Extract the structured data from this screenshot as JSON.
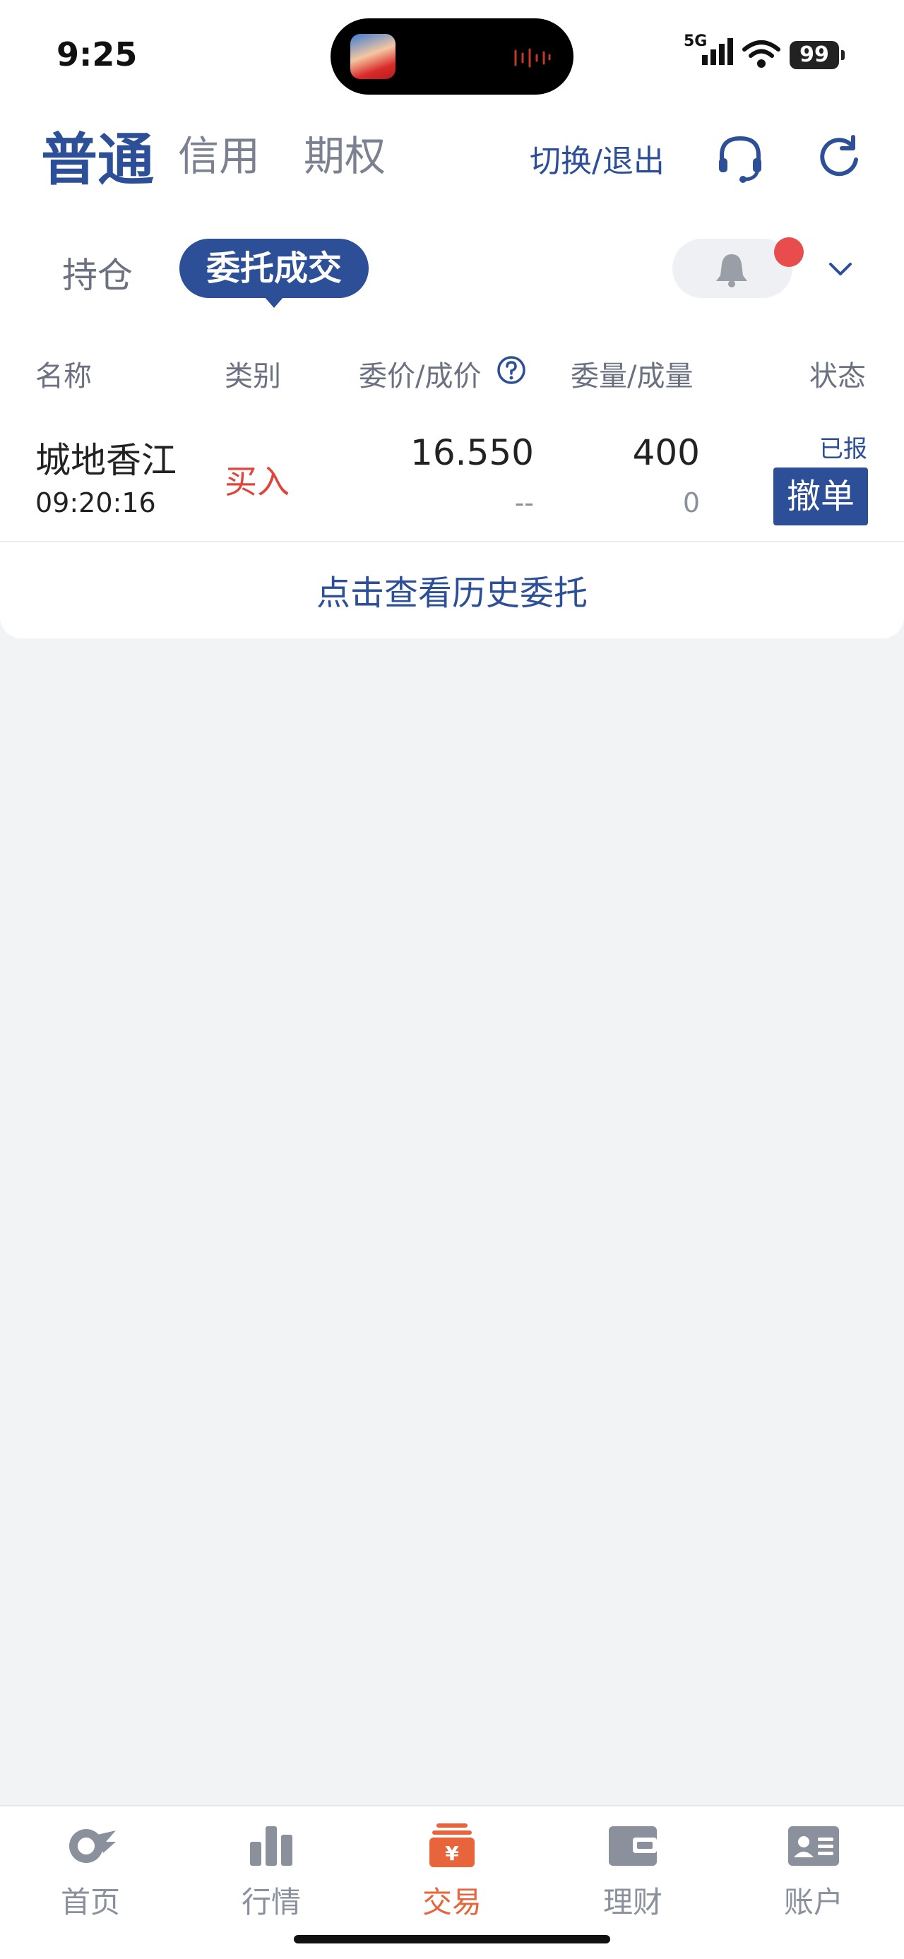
{
  "status_bar": {
    "time": "9:25",
    "network": "5G",
    "battery": "99"
  },
  "header": {
    "account_tabs": [
      "普通",
      "信用",
      "期权"
    ],
    "switch_logout": "切换/退出"
  },
  "subtabs": {
    "positions": "持仓",
    "orders": "委托成交"
  },
  "table": {
    "columns": [
      "名称",
      "类别",
      "委价/成价",
      "委量/成量",
      "状态"
    ],
    "rows": [
      {
        "name": "城地香江",
        "time": "09:20:16",
        "type": "买入",
        "order_price": "16.550",
        "deal_price": "--",
        "order_qty": "400",
        "deal_qty": "0",
        "status": "已报",
        "action": "撤单"
      }
    ]
  },
  "history_link": "点击查看历史委托",
  "bottom_nav": [
    {
      "label": "首页",
      "icon": "home-icon"
    },
    {
      "label": "行情",
      "icon": "chart-icon"
    },
    {
      "label": "交易",
      "icon": "trade-icon"
    },
    {
      "label": "理财",
      "icon": "wallet-icon"
    },
    {
      "label": "账户",
      "icon": "account-card-icon"
    }
  ],
  "colors": {
    "brand": "#2c4f98",
    "buy": "#e0443a",
    "active_nav": "#e8643a",
    "badge": "#e84c4c"
  }
}
